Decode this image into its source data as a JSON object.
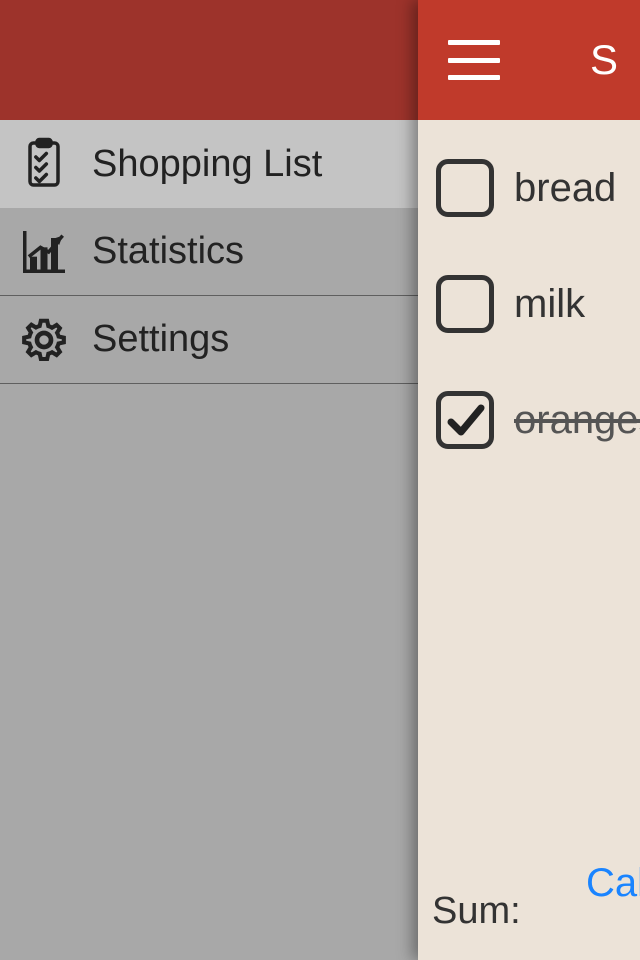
{
  "colors": {
    "accent": "#c03a2b",
    "accent_dim": "#9d332b",
    "link": "#1a84ff"
  },
  "sidebar": {
    "items": [
      {
        "label": "Shopping List",
        "icon": "clipboard-list-icon",
        "selected": true
      },
      {
        "label": "Statistics",
        "icon": "chart-icon",
        "selected": false
      },
      {
        "label": "Settings",
        "icon": "gear-icon",
        "selected": false
      }
    ]
  },
  "header": {
    "title_partial": "S"
  },
  "list": {
    "items": [
      {
        "label": "bread",
        "checked": false
      },
      {
        "label": "milk",
        "checked": false
      },
      {
        "label": "oranges",
        "checked": true
      }
    ]
  },
  "footer": {
    "sum_label": "Sum:",
    "calc_partial": "Cal"
  }
}
